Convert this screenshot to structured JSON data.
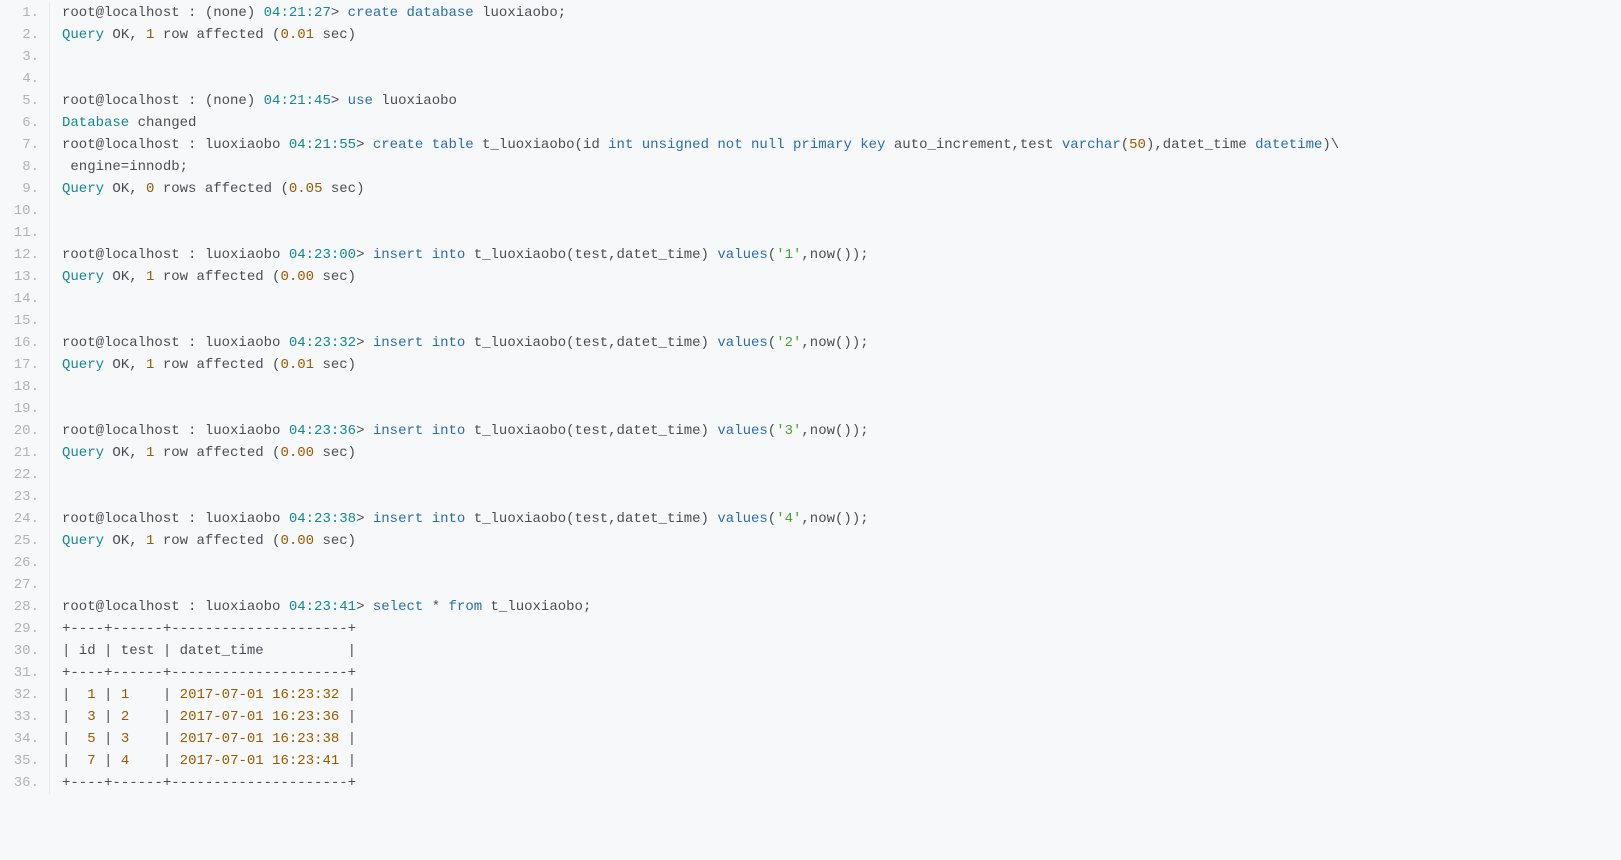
{
  "lines": [
    [
      {
        "t": "root@localhost : (none) ",
        "c": "c-plain"
      },
      {
        "t": "04:21:27",
        "c": "c-teal"
      },
      {
        "t": "> ",
        "c": "c-plain"
      },
      {
        "t": "create",
        "c": "c-blue"
      },
      {
        "t": " ",
        "c": "c-plain"
      },
      {
        "t": "database",
        "c": "c-blue"
      },
      {
        "t": " luoxiaobo;",
        "c": "c-plain"
      }
    ],
    [
      {
        "t": "Query",
        "c": "c-teal"
      },
      {
        "t": " OK, ",
        "c": "c-plain"
      },
      {
        "t": "1",
        "c": "c-brown"
      },
      {
        "t": " row affected (",
        "c": "c-plain"
      },
      {
        "t": "0.01",
        "c": "c-brown"
      },
      {
        "t": " sec)",
        "c": "c-plain"
      }
    ],
    [
      {
        "t": "",
        "c": "c-plain"
      }
    ],
    [
      {
        "t": "",
        "c": "c-plain"
      }
    ],
    [
      {
        "t": "root@localhost : (none) ",
        "c": "c-plain"
      },
      {
        "t": "04:21:45",
        "c": "c-teal"
      },
      {
        "t": "> ",
        "c": "c-plain"
      },
      {
        "t": "use",
        "c": "c-blue"
      },
      {
        "t": " luoxiaobo",
        "c": "c-plain"
      }
    ],
    [
      {
        "t": "Database",
        "c": "c-teal"
      },
      {
        "t": " changed",
        "c": "c-plain"
      }
    ],
    [
      {
        "t": "root@localhost : luoxiaobo ",
        "c": "c-plain"
      },
      {
        "t": "04:21:55",
        "c": "c-teal"
      },
      {
        "t": "> ",
        "c": "c-plain"
      },
      {
        "t": "create",
        "c": "c-blue"
      },
      {
        "t": " ",
        "c": "c-plain"
      },
      {
        "t": "table",
        "c": "c-blue"
      },
      {
        "t": " t_luoxiaobo(id ",
        "c": "c-plain"
      },
      {
        "t": "int",
        "c": "c-blue"
      },
      {
        "t": " ",
        "c": "c-plain"
      },
      {
        "t": "unsigned",
        "c": "c-blue"
      },
      {
        "t": " ",
        "c": "c-plain"
      },
      {
        "t": "not",
        "c": "c-blue"
      },
      {
        "t": " ",
        "c": "c-plain"
      },
      {
        "t": "null",
        "c": "c-blue"
      },
      {
        "t": " ",
        "c": "c-plain"
      },
      {
        "t": "primary",
        "c": "c-blue"
      },
      {
        "t": " ",
        "c": "c-plain"
      },
      {
        "t": "key",
        "c": "c-blue"
      },
      {
        "t": " auto_increment,test ",
        "c": "c-plain"
      },
      {
        "t": "varchar",
        "c": "c-blue"
      },
      {
        "t": "(",
        "c": "c-plain"
      },
      {
        "t": "50",
        "c": "c-brown"
      },
      {
        "t": "),datet_time ",
        "c": "c-plain"
      },
      {
        "t": "datetime",
        "c": "c-blue"
      },
      {
        "t": ")\\",
        "c": "c-plain"
      }
    ],
    [
      {
        "t": " engine=innodb;",
        "c": "c-plain"
      }
    ],
    [
      {
        "t": "Query",
        "c": "c-teal"
      },
      {
        "t": " OK, ",
        "c": "c-plain"
      },
      {
        "t": "0",
        "c": "c-brown"
      },
      {
        "t": " rows affected (",
        "c": "c-plain"
      },
      {
        "t": "0.05",
        "c": "c-brown"
      },
      {
        "t": " sec)",
        "c": "c-plain"
      }
    ],
    [
      {
        "t": "",
        "c": "c-plain"
      }
    ],
    [
      {
        "t": "",
        "c": "c-plain"
      }
    ],
    [
      {
        "t": "root@localhost : luoxiaobo ",
        "c": "c-plain"
      },
      {
        "t": "04:23:00",
        "c": "c-teal"
      },
      {
        "t": "> ",
        "c": "c-plain"
      },
      {
        "t": "insert",
        "c": "c-blue"
      },
      {
        "t": " ",
        "c": "c-plain"
      },
      {
        "t": "into",
        "c": "c-blue"
      },
      {
        "t": " t_luoxiaobo(test,datet_time) ",
        "c": "c-plain"
      },
      {
        "t": "values",
        "c": "c-blue"
      },
      {
        "t": "(",
        "c": "c-plain"
      },
      {
        "t": "'1'",
        "c": "c-green"
      },
      {
        "t": ",now());",
        "c": "c-plain"
      }
    ],
    [
      {
        "t": "Query",
        "c": "c-teal"
      },
      {
        "t": " OK, ",
        "c": "c-plain"
      },
      {
        "t": "1",
        "c": "c-brown"
      },
      {
        "t": " row affected (",
        "c": "c-plain"
      },
      {
        "t": "0.00",
        "c": "c-brown"
      },
      {
        "t": " sec)",
        "c": "c-plain"
      }
    ],
    [
      {
        "t": "",
        "c": "c-plain"
      }
    ],
    [
      {
        "t": "",
        "c": "c-plain"
      }
    ],
    [
      {
        "t": "root@localhost : luoxiaobo ",
        "c": "c-plain"
      },
      {
        "t": "04:23:32",
        "c": "c-teal"
      },
      {
        "t": "> ",
        "c": "c-plain"
      },
      {
        "t": "insert",
        "c": "c-blue"
      },
      {
        "t": " ",
        "c": "c-plain"
      },
      {
        "t": "into",
        "c": "c-blue"
      },
      {
        "t": " t_luoxiaobo(test,datet_time) ",
        "c": "c-plain"
      },
      {
        "t": "values",
        "c": "c-blue"
      },
      {
        "t": "(",
        "c": "c-plain"
      },
      {
        "t": "'2'",
        "c": "c-green"
      },
      {
        "t": ",now());",
        "c": "c-plain"
      }
    ],
    [
      {
        "t": "Query",
        "c": "c-teal"
      },
      {
        "t": " OK, ",
        "c": "c-plain"
      },
      {
        "t": "1",
        "c": "c-brown"
      },
      {
        "t": " row affected (",
        "c": "c-plain"
      },
      {
        "t": "0.01",
        "c": "c-brown"
      },
      {
        "t": " sec)",
        "c": "c-plain"
      }
    ],
    [
      {
        "t": "",
        "c": "c-plain"
      }
    ],
    [
      {
        "t": "",
        "c": "c-plain"
      }
    ],
    [
      {
        "t": "root@localhost : luoxiaobo ",
        "c": "c-plain"
      },
      {
        "t": "04:23:36",
        "c": "c-teal"
      },
      {
        "t": "> ",
        "c": "c-plain"
      },
      {
        "t": "insert",
        "c": "c-blue"
      },
      {
        "t": " ",
        "c": "c-plain"
      },
      {
        "t": "into",
        "c": "c-blue"
      },
      {
        "t": " t_luoxiaobo(test,datet_time) ",
        "c": "c-plain"
      },
      {
        "t": "values",
        "c": "c-blue"
      },
      {
        "t": "(",
        "c": "c-plain"
      },
      {
        "t": "'3'",
        "c": "c-green"
      },
      {
        "t": ",now());",
        "c": "c-plain"
      }
    ],
    [
      {
        "t": "Query",
        "c": "c-teal"
      },
      {
        "t": " OK, ",
        "c": "c-plain"
      },
      {
        "t": "1",
        "c": "c-brown"
      },
      {
        "t": " row affected (",
        "c": "c-plain"
      },
      {
        "t": "0.00",
        "c": "c-brown"
      },
      {
        "t": " sec)",
        "c": "c-plain"
      }
    ],
    [
      {
        "t": "",
        "c": "c-plain"
      }
    ],
    [
      {
        "t": "",
        "c": "c-plain"
      }
    ],
    [
      {
        "t": "root@localhost : luoxiaobo ",
        "c": "c-plain"
      },
      {
        "t": "04:23:38",
        "c": "c-teal"
      },
      {
        "t": "> ",
        "c": "c-plain"
      },
      {
        "t": "insert",
        "c": "c-blue"
      },
      {
        "t": " ",
        "c": "c-plain"
      },
      {
        "t": "into",
        "c": "c-blue"
      },
      {
        "t": " t_luoxiaobo(test,datet_time) ",
        "c": "c-plain"
      },
      {
        "t": "values",
        "c": "c-blue"
      },
      {
        "t": "(",
        "c": "c-plain"
      },
      {
        "t": "'4'",
        "c": "c-green"
      },
      {
        "t": ",now());",
        "c": "c-plain"
      }
    ],
    [
      {
        "t": "Query",
        "c": "c-teal"
      },
      {
        "t": " OK, ",
        "c": "c-plain"
      },
      {
        "t": "1",
        "c": "c-brown"
      },
      {
        "t": " row affected (",
        "c": "c-plain"
      },
      {
        "t": "0.00",
        "c": "c-brown"
      },
      {
        "t": " sec)",
        "c": "c-plain"
      }
    ],
    [
      {
        "t": "",
        "c": "c-plain"
      }
    ],
    [
      {
        "t": "",
        "c": "c-plain"
      }
    ],
    [
      {
        "t": "root@localhost : luoxiaobo ",
        "c": "c-plain"
      },
      {
        "t": "04:23:41",
        "c": "c-teal"
      },
      {
        "t": "> ",
        "c": "c-plain"
      },
      {
        "t": "select",
        "c": "c-blue"
      },
      {
        "t": " * ",
        "c": "c-plain"
      },
      {
        "t": "from",
        "c": "c-blue"
      },
      {
        "t": " t_luoxiaobo;",
        "c": "c-plain"
      }
    ],
    [
      {
        "t": "+----+------+---------------------+",
        "c": "c-plain"
      }
    ],
    [
      {
        "t": "| id | test | datet_time          |",
        "c": "c-plain"
      }
    ],
    [
      {
        "t": "+----+------+---------------------+",
        "c": "c-plain"
      }
    ],
    [
      {
        "t": "|  ",
        "c": "c-plain"
      },
      {
        "t": "1",
        "c": "c-brown"
      },
      {
        "t": " | ",
        "c": "c-plain"
      },
      {
        "t": "1",
        "c": "c-brown"
      },
      {
        "t": "    | ",
        "c": "c-plain"
      },
      {
        "t": "2017-07-01 16:23:32",
        "c": "c-brown"
      },
      {
        "t": " |",
        "c": "c-plain"
      }
    ],
    [
      {
        "t": "|  ",
        "c": "c-plain"
      },
      {
        "t": "3",
        "c": "c-brown"
      },
      {
        "t": " | ",
        "c": "c-plain"
      },
      {
        "t": "2",
        "c": "c-brown"
      },
      {
        "t": "    | ",
        "c": "c-plain"
      },
      {
        "t": "2017-07-01 16:23:36",
        "c": "c-brown"
      },
      {
        "t": " |",
        "c": "c-plain"
      }
    ],
    [
      {
        "t": "|  ",
        "c": "c-plain"
      },
      {
        "t": "5",
        "c": "c-brown"
      },
      {
        "t": " | ",
        "c": "c-plain"
      },
      {
        "t": "3",
        "c": "c-brown"
      },
      {
        "t": "    | ",
        "c": "c-plain"
      },
      {
        "t": "2017-07-01 16:23:38",
        "c": "c-brown"
      },
      {
        "t": " |",
        "c": "c-plain"
      }
    ],
    [
      {
        "t": "|  ",
        "c": "c-plain"
      },
      {
        "t": "7",
        "c": "c-brown"
      },
      {
        "t": " | ",
        "c": "c-plain"
      },
      {
        "t": "4",
        "c": "c-brown"
      },
      {
        "t": "    | ",
        "c": "c-plain"
      },
      {
        "t": "2017-07-01 16:23:41",
        "c": "c-brown"
      },
      {
        "t": " |",
        "c": "c-plain"
      }
    ],
    [
      {
        "t": "+----+------+---------------------+",
        "c": "c-plain"
      }
    ]
  ]
}
